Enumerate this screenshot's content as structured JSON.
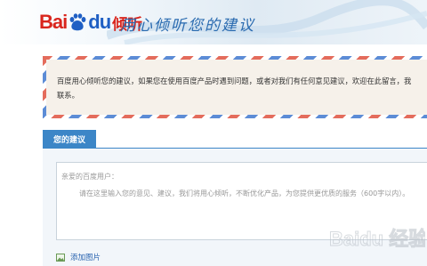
{
  "header": {
    "logo_bai": "Bai",
    "logo_du": "du",
    "logo_qing": "倾听",
    "slogan": "用心倾听您的建议"
  },
  "notice": {
    "line1": "百度用心倾听您的建议，如果您在使用百度产品时遇到问题，或者对我们有任何意见建议，欢迎在此留言，我",
    "line2": "联系。"
  },
  "form": {
    "tab_label": "您的建议",
    "greeting": "亲爱的百度用户：",
    "placeholder_body": "请在这里输入您的意见、建议，我们将用心倾听，不断优化产品，为您提供更优质的服务（600字以内）。",
    "add_image_label": "添加图片"
  },
  "watermark": {
    "text": "Baidu 经验"
  },
  "colors": {
    "brand_red": "#d9251d",
    "brand_blue": "#1f5fc4",
    "tab_blue": "#3c86c7"
  }
}
